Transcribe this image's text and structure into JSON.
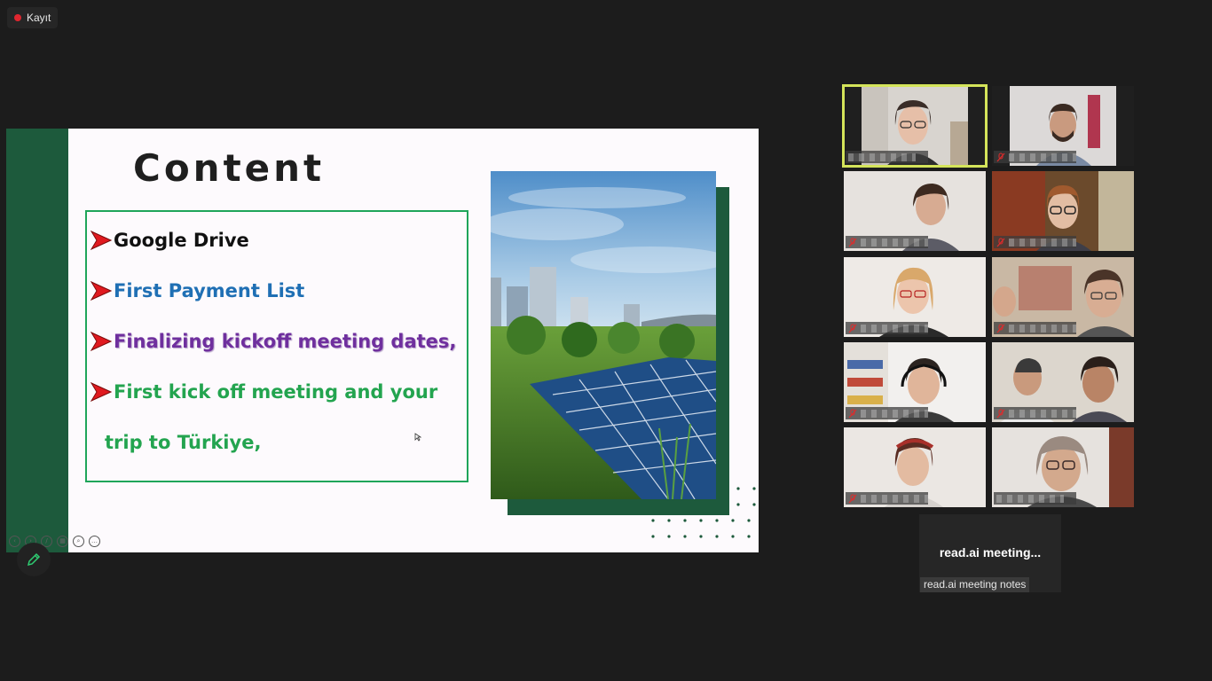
{
  "recording": {
    "label": "Kayıt",
    "color": "#e0262f"
  },
  "slide": {
    "title": "Content",
    "bullets": [
      "Google Drive",
      "First Payment List",
      "Finalizing kickoff meeting dates,",
      "First kick off  meeting and your",
      "trip to Türkiye,"
    ],
    "colors": {
      "band": "#1d5a3c",
      "box_border": "#1fa55a",
      "arrow": "#e0191f"
    },
    "image": "solar-panels-city-skyline"
  },
  "gallery": {
    "participants": [
      {
        "id": "p1",
        "speaking": true,
        "muted": false,
        "avatar": "woman-glasses-dark-hair"
      },
      {
        "id": "p2",
        "speaking": false,
        "muted": true,
        "avatar": "man-beard"
      },
      {
        "id": "p3",
        "speaking": false,
        "muted": true,
        "avatar": "woman-dark-hair"
      },
      {
        "id": "p4",
        "speaking": false,
        "muted": true,
        "avatar": "woman-glasses-red-hair"
      },
      {
        "id": "p5",
        "speaking": false,
        "muted": true,
        "avatar": "woman-blonde-glasses"
      },
      {
        "id": "p6",
        "speaking": false,
        "muted": true,
        "avatar": "two-people-glasses"
      },
      {
        "id": "p7",
        "speaking": false,
        "muted": true,
        "avatar": "man-headset-bookshelf"
      },
      {
        "id": "p8",
        "speaking": false,
        "muted": true,
        "avatar": "man-and-woman"
      },
      {
        "id": "p9",
        "speaking": false,
        "muted": true,
        "avatar": "woman-headband"
      },
      {
        "id": "p10",
        "speaking": false,
        "muted": false,
        "avatar": "older-woman-glasses"
      }
    ],
    "bot": {
      "label": "read.ai  meeting...",
      "name_tag": "read.ai meeting notes"
    }
  }
}
